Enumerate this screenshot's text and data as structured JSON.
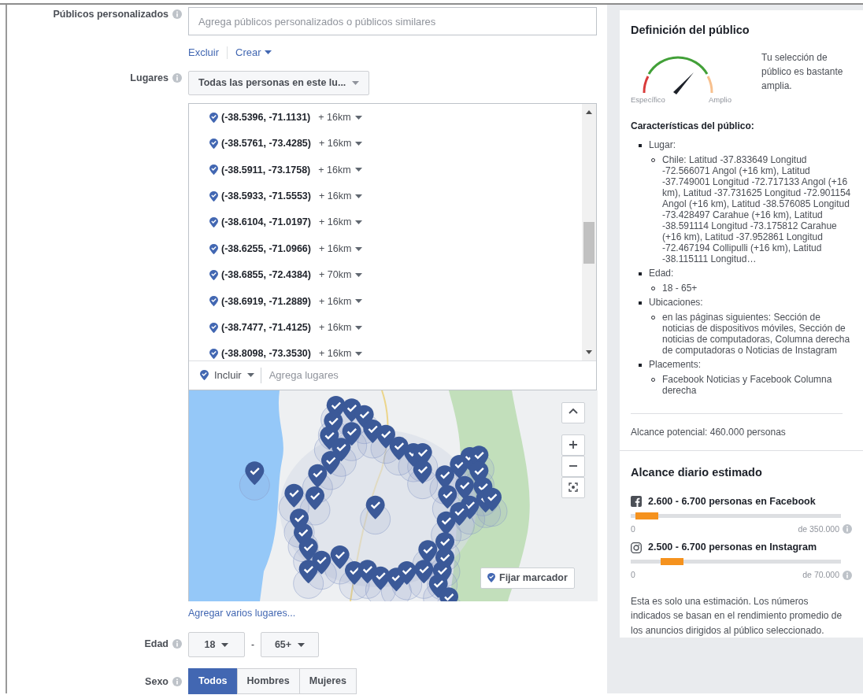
{
  "custom_audiences": {
    "label": "Públicos personalizados",
    "placeholder": "Agrega públicos personalizados o públicos similares",
    "links": [
      {
        "label": "Excluir",
        "dropdown": false
      },
      {
        "label": "Crear",
        "dropdown": true
      }
    ]
  },
  "locations": {
    "label": "Lugares",
    "dropdown": "Todas las personas en este lu...",
    "items": [
      {
        "coords": "(-38.5396, -71.1131)",
        "radius": "+ 16km"
      },
      {
        "coords": "(-38.5761, -73.4285)",
        "radius": "+ 16km"
      },
      {
        "coords": "(-38.5911, -73.1758)",
        "radius": "+ 16km"
      },
      {
        "coords": "(-38.5933, -71.5553)",
        "radius": "+ 16km"
      },
      {
        "coords": "(-38.6104, -71.0197)",
        "radius": "+ 16km"
      },
      {
        "coords": "(-38.6255, -71.0966)",
        "radius": "+ 16km"
      },
      {
        "coords": "(-38.6855, -72.4384)",
        "radius": "+ 70km"
      },
      {
        "coords": "(-38.6919, -71.2889)",
        "radius": "+ 16km"
      },
      {
        "coords": "(-38.7477, -71.4125)",
        "radius": "+ 16km"
      },
      {
        "coords": "(-38.8098, -73.3530)",
        "radius": "+ 16km"
      }
    ],
    "include": "Incluir",
    "placeholder": "Agrega lugares",
    "pin_button": "Fijar marcador",
    "bulk_link": "Agregar varios lugares..."
  },
  "age": {
    "label": "Edad",
    "min": "18",
    "separator": "-",
    "max": "65+"
  },
  "gender": {
    "label": "Sexo",
    "options": [
      {
        "label": "Todos",
        "selected": true
      },
      {
        "label": "Hombres",
        "selected": false
      },
      {
        "label": "Mujeres",
        "selected": false
      }
    ]
  },
  "audience_definition": {
    "title": "Definición del público",
    "gauge_labels": [
      "Específico",
      "Amplio"
    ],
    "summary": "Tu selección de público es bastante amplia.",
    "characteristics_title": "Características del público:",
    "characteristics": [
      {
        "label": "Lugar:",
        "children": [
          {
            "label": "Chile: Latitud -37.833649 Longitud -72.566071 Angol (+16 km), Latitud -37.749001 Longitud -72.717133 Angol (+16 km), Latitud -37.731625 Longitud -72.901154 Angol (+16 km), Latitud -38.576085 Longitud -73.428497 Carahue (+16 km), Latitud -38.591114 Longitud -73.175812 Carahue (+16 km), Latitud -37.952861 Longitud -72.467194 Collipulli (+16 km), Latitud -38.115111 Longitud…"
          }
        ]
      },
      {
        "label": "Edad:",
        "children": [
          {
            "label": "18 - 65+"
          }
        ]
      },
      {
        "label": "Ubicaciones:",
        "children": [
          {
            "label": "en las páginas siguientes: Sección de noticias de dispositivos móviles, Sección de noticias de computadoras, Columna derecha de computadoras o Noticias de Instagram"
          }
        ]
      },
      {
        "label": "Placements:",
        "children": [
          {
            "label": "Facebook Noticias y Facebook Columna derecha"
          }
        ]
      }
    ],
    "potential_reach": "Alcance potencial: 460.000 personas"
  },
  "daily_reach": {
    "title": "Alcance diario estimado",
    "platforms": [
      {
        "kind": "facebook",
        "label": "2.600 - 6.700 personas en Facebook",
        "level": 0.13,
        "min": "0",
        "max": "de 350.000"
      },
      {
        "kind": "instagram",
        "label": "2.500 - 6.700 personas en Instagram",
        "level": 0.25,
        "min": "0",
        "max": "de 70.000"
      }
    ],
    "note": "Esta es solo una estimación. Los números indicados se basan en el rendimiento promedio de los anuncios dirigidos al público seleccionado."
  }
}
